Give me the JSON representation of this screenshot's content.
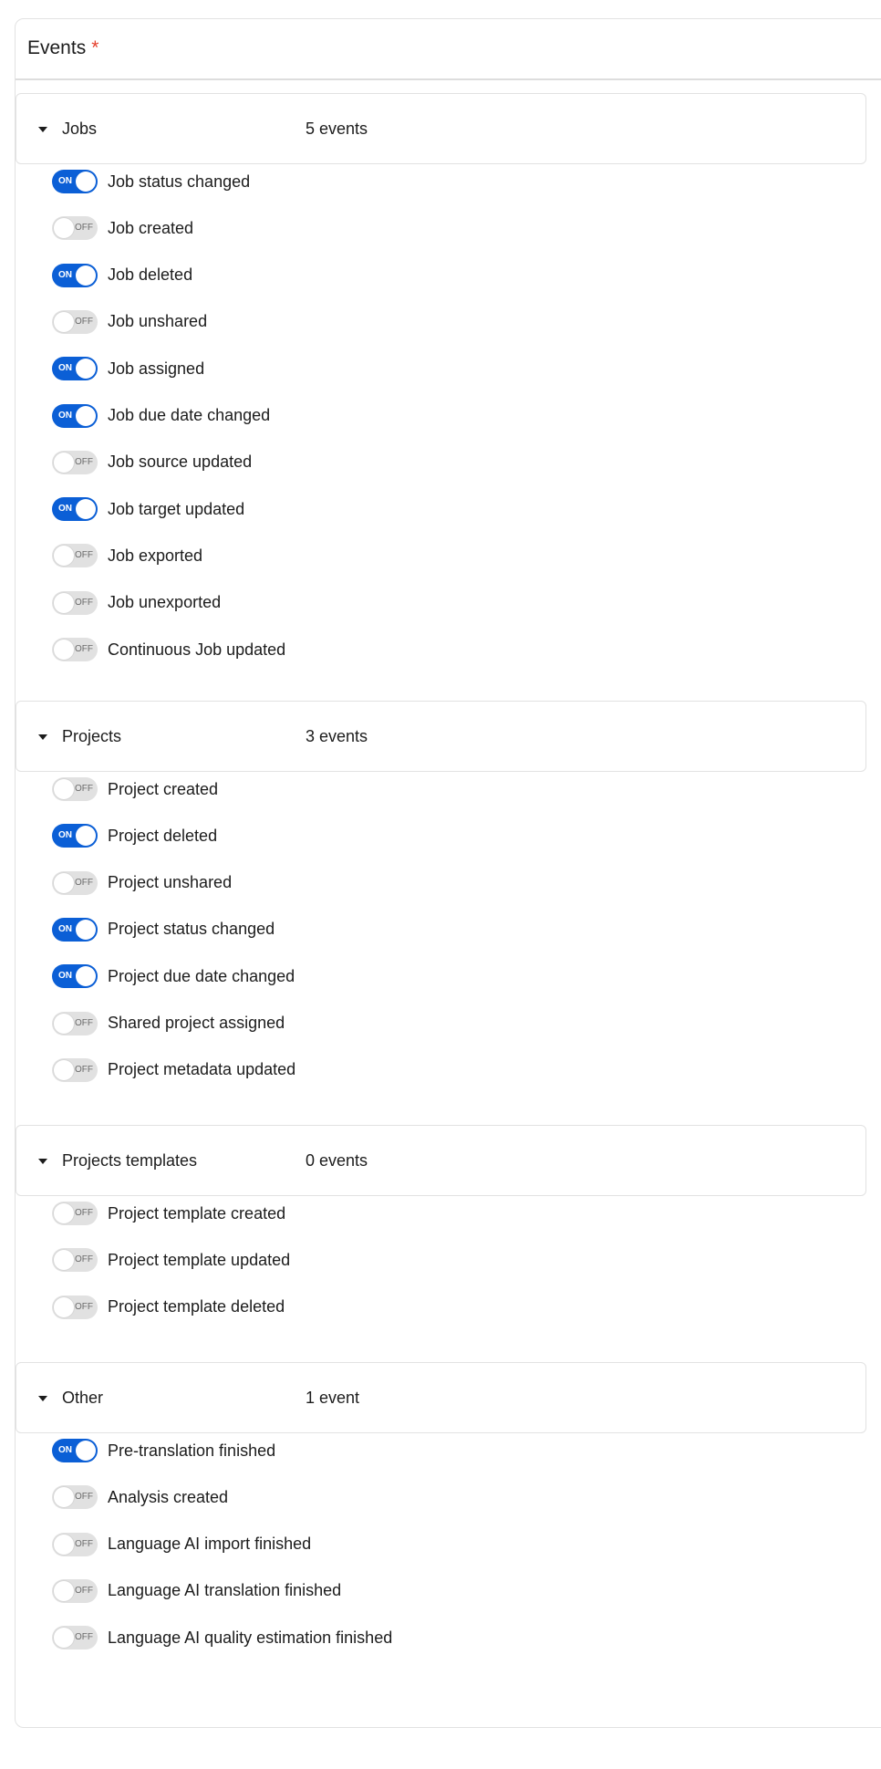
{
  "card": {
    "title": "Events",
    "required_mark": "*"
  },
  "colors": {
    "accent": "#0b5fd6",
    "required": "#e5422f",
    "toggle_off": "#e1e1e1"
  },
  "toggle_text": {
    "on": "ON",
    "off": "OFF"
  },
  "groups": [
    {
      "title": "Jobs",
      "count": "5 events",
      "expanded": true,
      "items": [
        {
          "label": "Job status changed",
          "on": true
        },
        {
          "label": "Job created",
          "on": false
        },
        {
          "label": "Job deleted",
          "on": true
        },
        {
          "label": "Job unshared",
          "on": false
        },
        {
          "label": "Job assigned",
          "on": true
        },
        {
          "label": "Job due date changed",
          "on": true
        },
        {
          "label": "Job source updated",
          "on": false
        },
        {
          "label": "Job target updated",
          "on": true
        },
        {
          "label": "Job exported",
          "on": false
        },
        {
          "label": "Job unexported",
          "on": false
        },
        {
          "label": "Continuous Job updated",
          "on": false
        }
      ]
    },
    {
      "title": "Projects",
      "count": "3 events",
      "expanded": true,
      "items": [
        {
          "label": "Project created",
          "on": false
        },
        {
          "label": "Project deleted",
          "on": true
        },
        {
          "label": "Project unshared",
          "on": false
        },
        {
          "label": "Project status changed",
          "on": true
        },
        {
          "label": "Project due date changed",
          "on": true
        },
        {
          "label": "Shared project assigned",
          "on": false
        },
        {
          "label": "Project metadata updated",
          "on": false
        }
      ]
    },
    {
      "title": "Projects templates",
      "count": "0 events",
      "expanded": true,
      "items": [
        {
          "label": "Project template created",
          "on": false
        },
        {
          "label": "Project template updated",
          "on": false
        },
        {
          "label": "Project template deleted",
          "on": false
        }
      ]
    },
    {
      "title": "Other",
      "count": "1 event",
      "expanded": true,
      "items": [
        {
          "label": "Pre-translation finished",
          "on": true
        },
        {
          "label": "Analysis created",
          "on": false
        },
        {
          "label": "Language AI import finished",
          "on": false
        },
        {
          "label": "Language AI translation finished",
          "on": false
        },
        {
          "label": "Language AI quality estimation finished",
          "on": false
        }
      ]
    }
  ]
}
